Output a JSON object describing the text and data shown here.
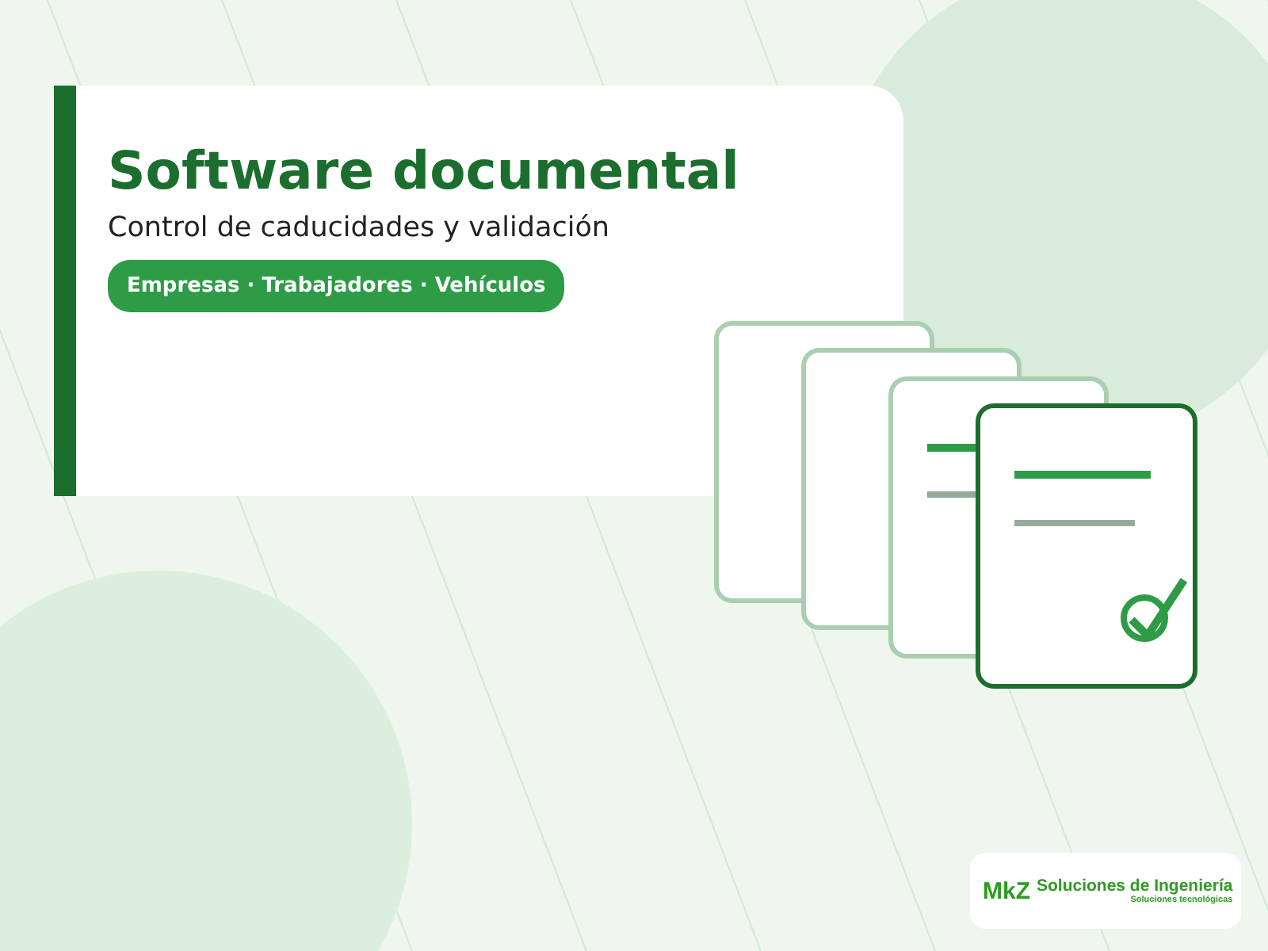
{
  "hero": {
    "title": "Software documental",
    "subtitle": "Control de caducidades y validación",
    "tag": "Empresas · Trabajadores · Vehículos"
  },
  "logo": {
    "mark": "MkZ",
    "name": "Soluciones de Ingeniería",
    "tagline": "Soluciones tecnológicas"
  }
}
